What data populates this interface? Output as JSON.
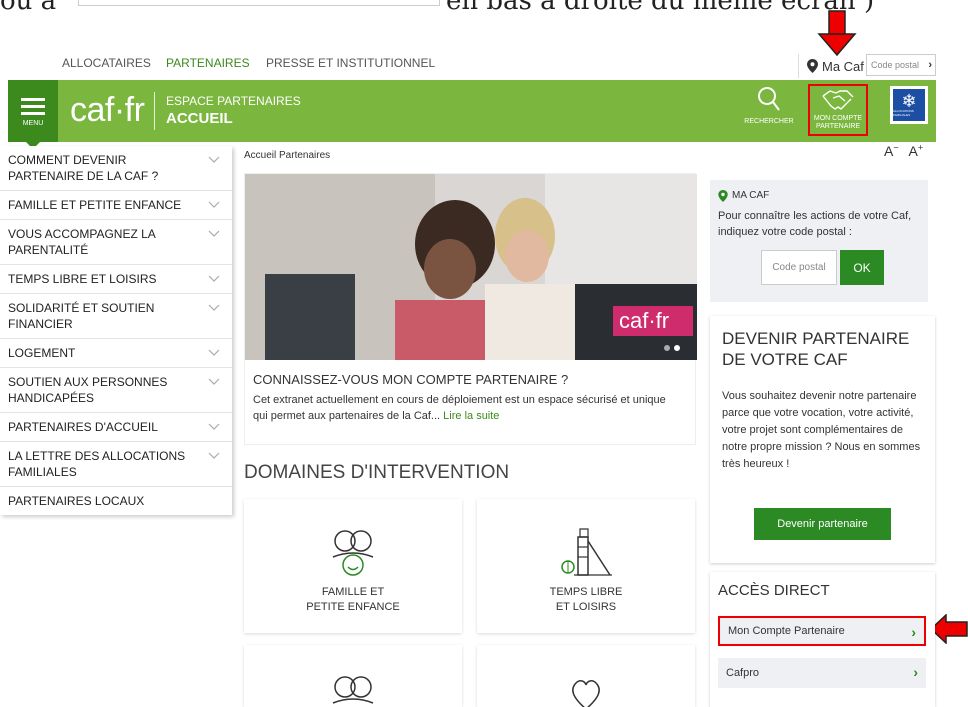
{
  "caption": {
    "left": "ou à",
    "right": "en bas à droite du même écran )"
  },
  "topnav": {
    "links": [
      "ALLOCATAIRES",
      "PARTENAIRES",
      "PRESSE ET INSTITUTIONNEL"
    ],
    "ma_caf": "Ma Caf",
    "code_postal_placeholder": "Code postal"
  },
  "header": {
    "menu_label": "MENU",
    "logo": "caf·fr",
    "subtitle": "ESPACE PARTENAIRES",
    "title": "ACCUEIL",
    "search_label": "RECHERCHER",
    "compte_label": "MON COMPTE PARTENAIRE"
  },
  "leftmenu": [
    "COMMENT DEVENIR PARTENAIRE DE LA CAF ?",
    "FAMILLE ET PETITE ENFANCE",
    "VOUS ACCOMPAGNEZ LA PARENTALITÉ",
    "TEMPS LIBRE ET LOISIRS",
    "SOLIDARITÉ ET SOUTIEN FINANCIER",
    "LOGEMENT",
    "SOUTIEN AUX PERSONNES HANDICAPÉES",
    "PARTENAIRES D'ACCUEIL",
    "LA LETTRE DES ALLOCATIONS FAMILIALES",
    "PARTENAIRES LOCAUX"
  ],
  "breadcrumb": "Accueil Partenaires",
  "fontsize": {
    "minus": "A",
    "plus": "A"
  },
  "hero": {
    "badge": "caf·fr",
    "title": "CONNAISSEZ-VOUS MON COMPTE PARTENAIRE ?",
    "text": "Cet extranet actuellement en cours de déploiement est un espace sécurisé et unique qui permet aux partenaires de la Caf...",
    "more": "Lire la suite"
  },
  "domaines": {
    "title": "DOMAINES D'INTERVENTION",
    "cards": [
      "FAMILLE ET\nPETITE ENFANCE",
      "TEMPS LIBRE\nET LOISIRS"
    ]
  },
  "macaf_box": {
    "heading": "MA CAF",
    "text": "Pour connaître les actions de votre Caf, indiquez votre code postal :",
    "placeholder": "Code postal",
    "ok": "OK"
  },
  "devenir": {
    "title": "DEVENIR PARTENAIRE DE VOTRE CAF",
    "text": "Vous souhaitez devenir notre partenaire parce que votre vocation, votre activité, votre projet sont complémentaires de notre propre mission ? Nous en sommes très heureux !",
    "button": "Devenir partenaire"
  },
  "acces": {
    "title": "ACCÈS DIRECT",
    "links": [
      "Mon Compte Partenaire",
      "Cafpro"
    ]
  },
  "colors": {
    "green": "#7bb63f",
    "dark_green": "#2c8a24",
    "highlight": "#e00000"
  }
}
